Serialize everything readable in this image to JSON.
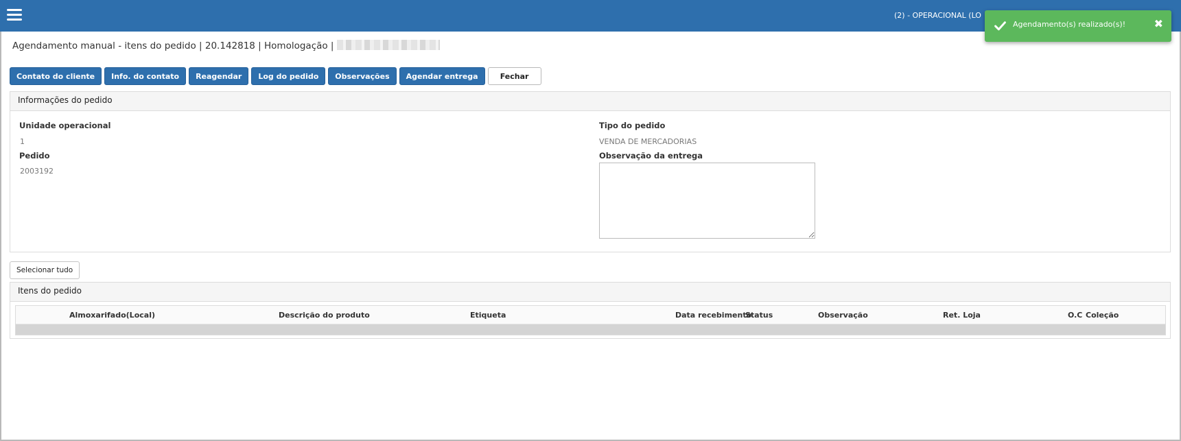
{
  "topbar": {
    "env_text": "(2) - OPERACIONAL (LO"
  },
  "toast": {
    "message": "Agendamento(s) realizado(s)!",
    "close_symbol": "✖",
    "color": "#5cb85c"
  },
  "page": {
    "title": "Agendamento manual - itens do pedido | 20.142818 | Homologação |"
  },
  "toolbar": {
    "buttons": [
      "Contato do cliente",
      "Info. do contato",
      "Reagendar",
      "Log do pedido",
      "Observações",
      "Agendar entrega",
      "Fechar"
    ]
  },
  "order_info": {
    "heading": "Informações do pedido",
    "unidade_label": "Unidade operacional",
    "unidade_value": "1",
    "pedido_label": "Pedido",
    "pedido_value": "2003192",
    "tipo_label": "Tipo do pedido",
    "tipo_value": "VENDA DE MERCADORIAS",
    "obs_label": "Observação da entrega",
    "obs_value": ""
  },
  "select_all_label": "Selecionar tudo",
  "items": {
    "heading": "Itens do pedido",
    "columns": [
      "Almoxarifado(Local)",
      "Descrição do produto",
      "Etiqueta",
      "Data recebimento",
      "Status",
      "Observação",
      "Ret. Loja",
      "O.C",
      "Coleção"
    ],
    "rows": []
  },
  "colors": {
    "primary": "#2e6fad",
    "success": "#5cb85c"
  }
}
